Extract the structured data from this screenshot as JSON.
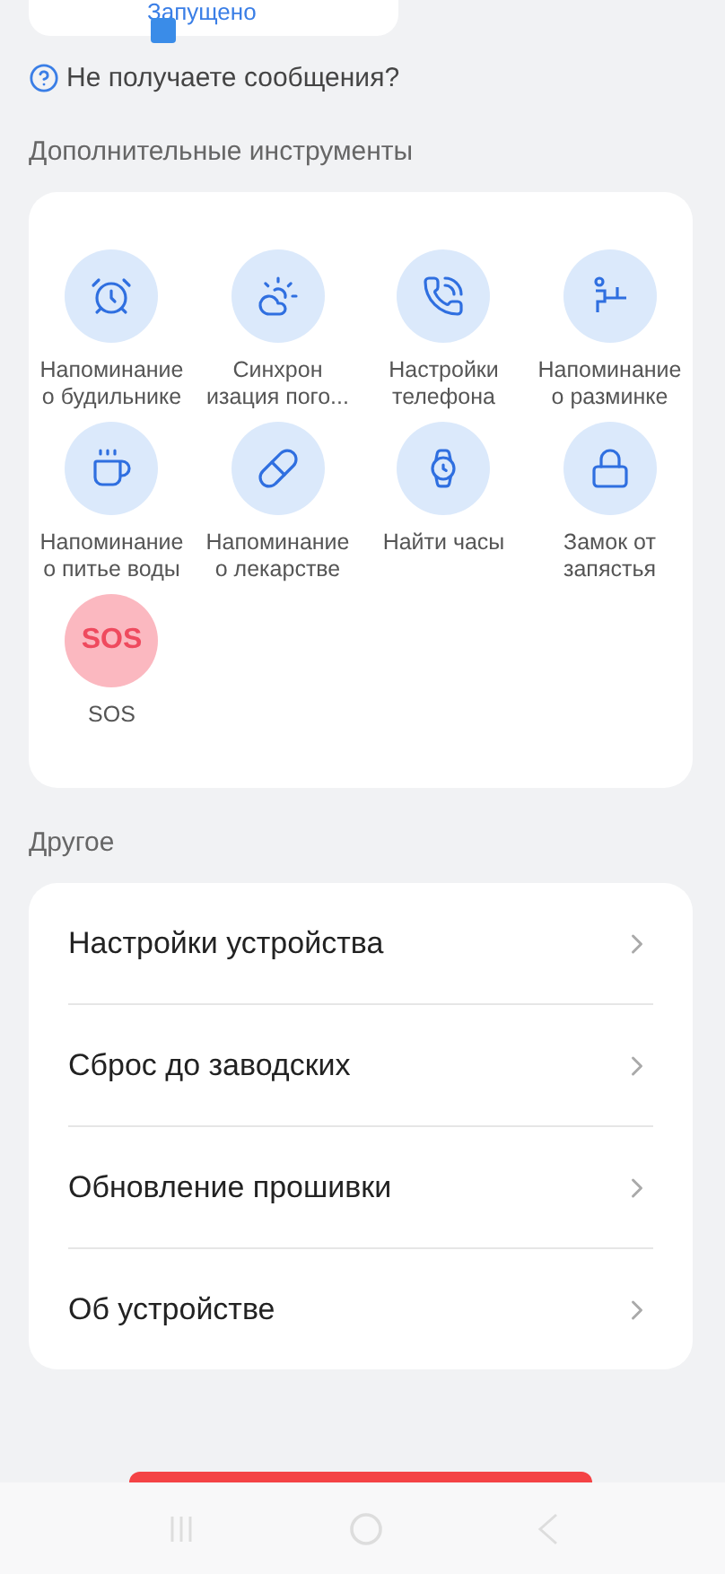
{
  "notification": {
    "status": "Запущено"
  },
  "help_link": "Не получаете сообщения?",
  "tools_section": {
    "title": "Дополнительные инструменты",
    "tools": [
      {
        "label": "Напоминание о будильнике",
        "kind": "icon"
      },
      {
        "label": "Синхрон изация пого...",
        "kind": "icon"
      },
      {
        "label": "Настройки телефона",
        "kind": "icon"
      },
      {
        "label": "Напоминание о разминке",
        "kind": "icon"
      },
      {
        "label": "Напоминание о питье воды",
        "kind": "icon"
      },
      {
        "label": "Напоминание о лекарстве",
        "kind": "icon"
      },
      {
        "label": "Найти часы",
        "kind": "icon"
      },
      {
        "label": "Замок от запястья",
        "kind": "icon"
      },
      {
        "label": "SOS",
        "kind": "sos",
        "badge": "SOS"
      }
    ]
  },
  "other_section": {
    "title": "Другое",
    "items": [
      {
        "label": "Настройки устройства"
      },
      {
        "label": "Сброс до заводских"
      },
      {
        "label": "Обновление прошивки"
      },
      {
        "label": "Об устройстве"
      }
    ]
  }
}
